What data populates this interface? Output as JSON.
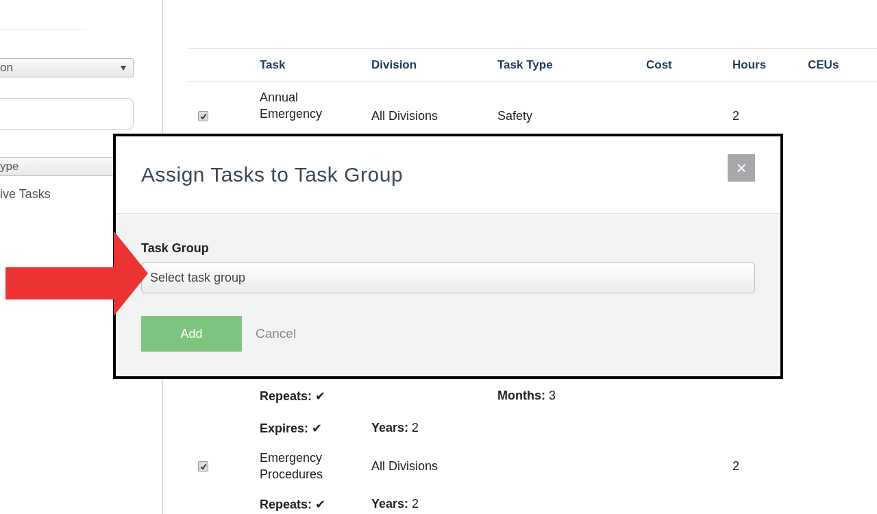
{
  "sidebar": {
    "division_select": {
      "value": "on"
    },
    "type_select": {
      "value": "ype"
    },
    "filter_label": "ive Tasks"
  },
  "table": {
    "columns": [
      "Task",
      "Division",
      "Task Type",
      "Cost",
      "Hours",
      "CEUs"
    ],
    "rows": [
      {
        "kind": "task",
        "checked": true,
        "task": "Annual Emergency",
        "division": "All Divisions",
        "task_type": "Safety",
        "hours": "2"
      },
      {
        "kind": "detail",
        "task": {
          "label": "Repeats:",
          "value": "✔"
        },
        "task_type": {
          "label": "Months:",
          "value": "3"
        }
      },
      {
        "kind": "detail",
        "task": {
          "label": "Expires:",
          "value": "✔"
        },
        "division": {
          "label": "Years:",
          "value": "2"
        }
      },
      {
        "kind": "task",
        "checked": true,
        "task": "Emergency Procedures",
        "division": "All Divisions",
        "hours": "2"
      },
      {
        "kind": "detail",
        "task": {
          "label": "Repeats:",
          "value": "✔"
        },
        "division": {
          "label": "Years:",
          "value": "2"
        }
      }
    ]
  },
  "modal": {
    "title": "Assign Tasks to Task Group",
    "close": "×",
    "field_label": "Task Group",
    "field": {
      "placeholder": "Select task group"
    },
    "buttons": [
      {
        "label": "Add",
        "disabled": true
      },
      {
        "label": "Cancel",
        "kind": "link"
      }
    ]
  }
}
